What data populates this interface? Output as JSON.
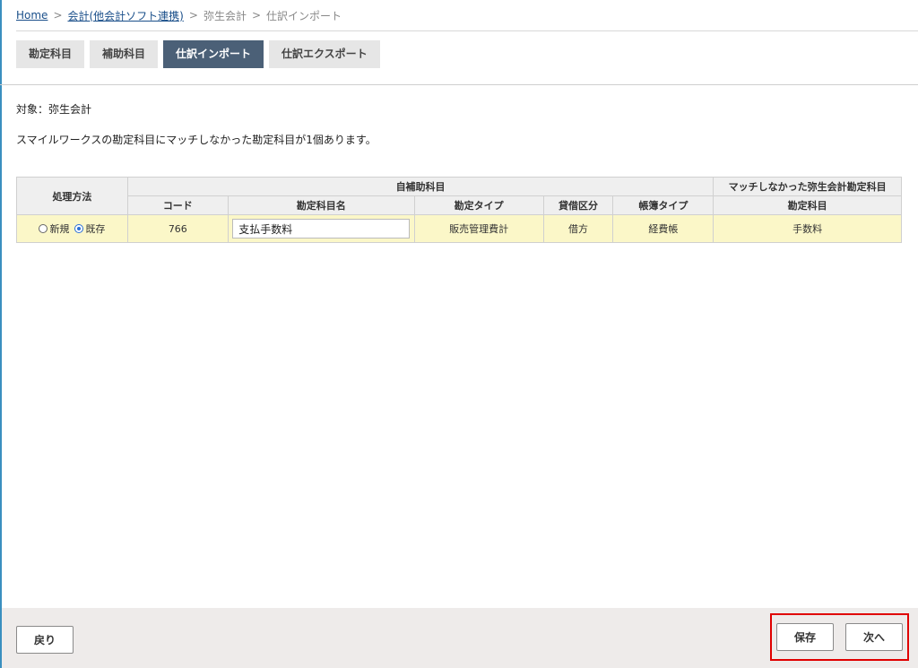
{
  "breadcrumb": {
    "home": "Home",
    "accounting": "会計(他会計ソフト連携)",
    "yayoi": "弥生会計",
    "current": "仕訳インポート",
    "separator": ">"
  },
  "tabs": [
    {
      "label": "勘定科目",
      "active": false
    },
    {
      "label": "補助科目",
      "active": false
    },
    {
      "label": "仕訳インポート",
      "active": true
    },
    {
      "label": "仕訳エクスポート",
      "active": false
    }
  ],
  "target_text": "対象：弥生会計",
  "message_text": "スマイルワークスの勘定科目にマッチしなかった勘定科目が1個あります。",
  "table": {
    "header_method": "処理方法",
    "header_own": "自補助科目",
    "header_unmatched": "マッチしなかった弥生会計勘定科目",
    "columns": [
      "コード",
      "勘定科目名",
      "勘定タイプ",
      "貸借区分",
      "帳簿タイプ",
      "勘定科目"
    ],
    "row": {
      "radio_new": "新規",
      "radio_existing": "既存",
      "selected": "既存",
      "code": "766",
      "account_name": "支払手数料",
      "account_type": "販売管理費計",
      "debit_credit": "借方",
      "book_type": "経費帳",
      "unmatched_account": "手数料"
    }
  },
  "buttons": {
    "back": "戻り",
    "save": "保存",
    "next": "次へ"
  },
  "colors": {
    "active_tab": "#4b6077",
    "row_highlight": "#fbf7c8",
    "annotation_box": "#e00000"
  }
}
